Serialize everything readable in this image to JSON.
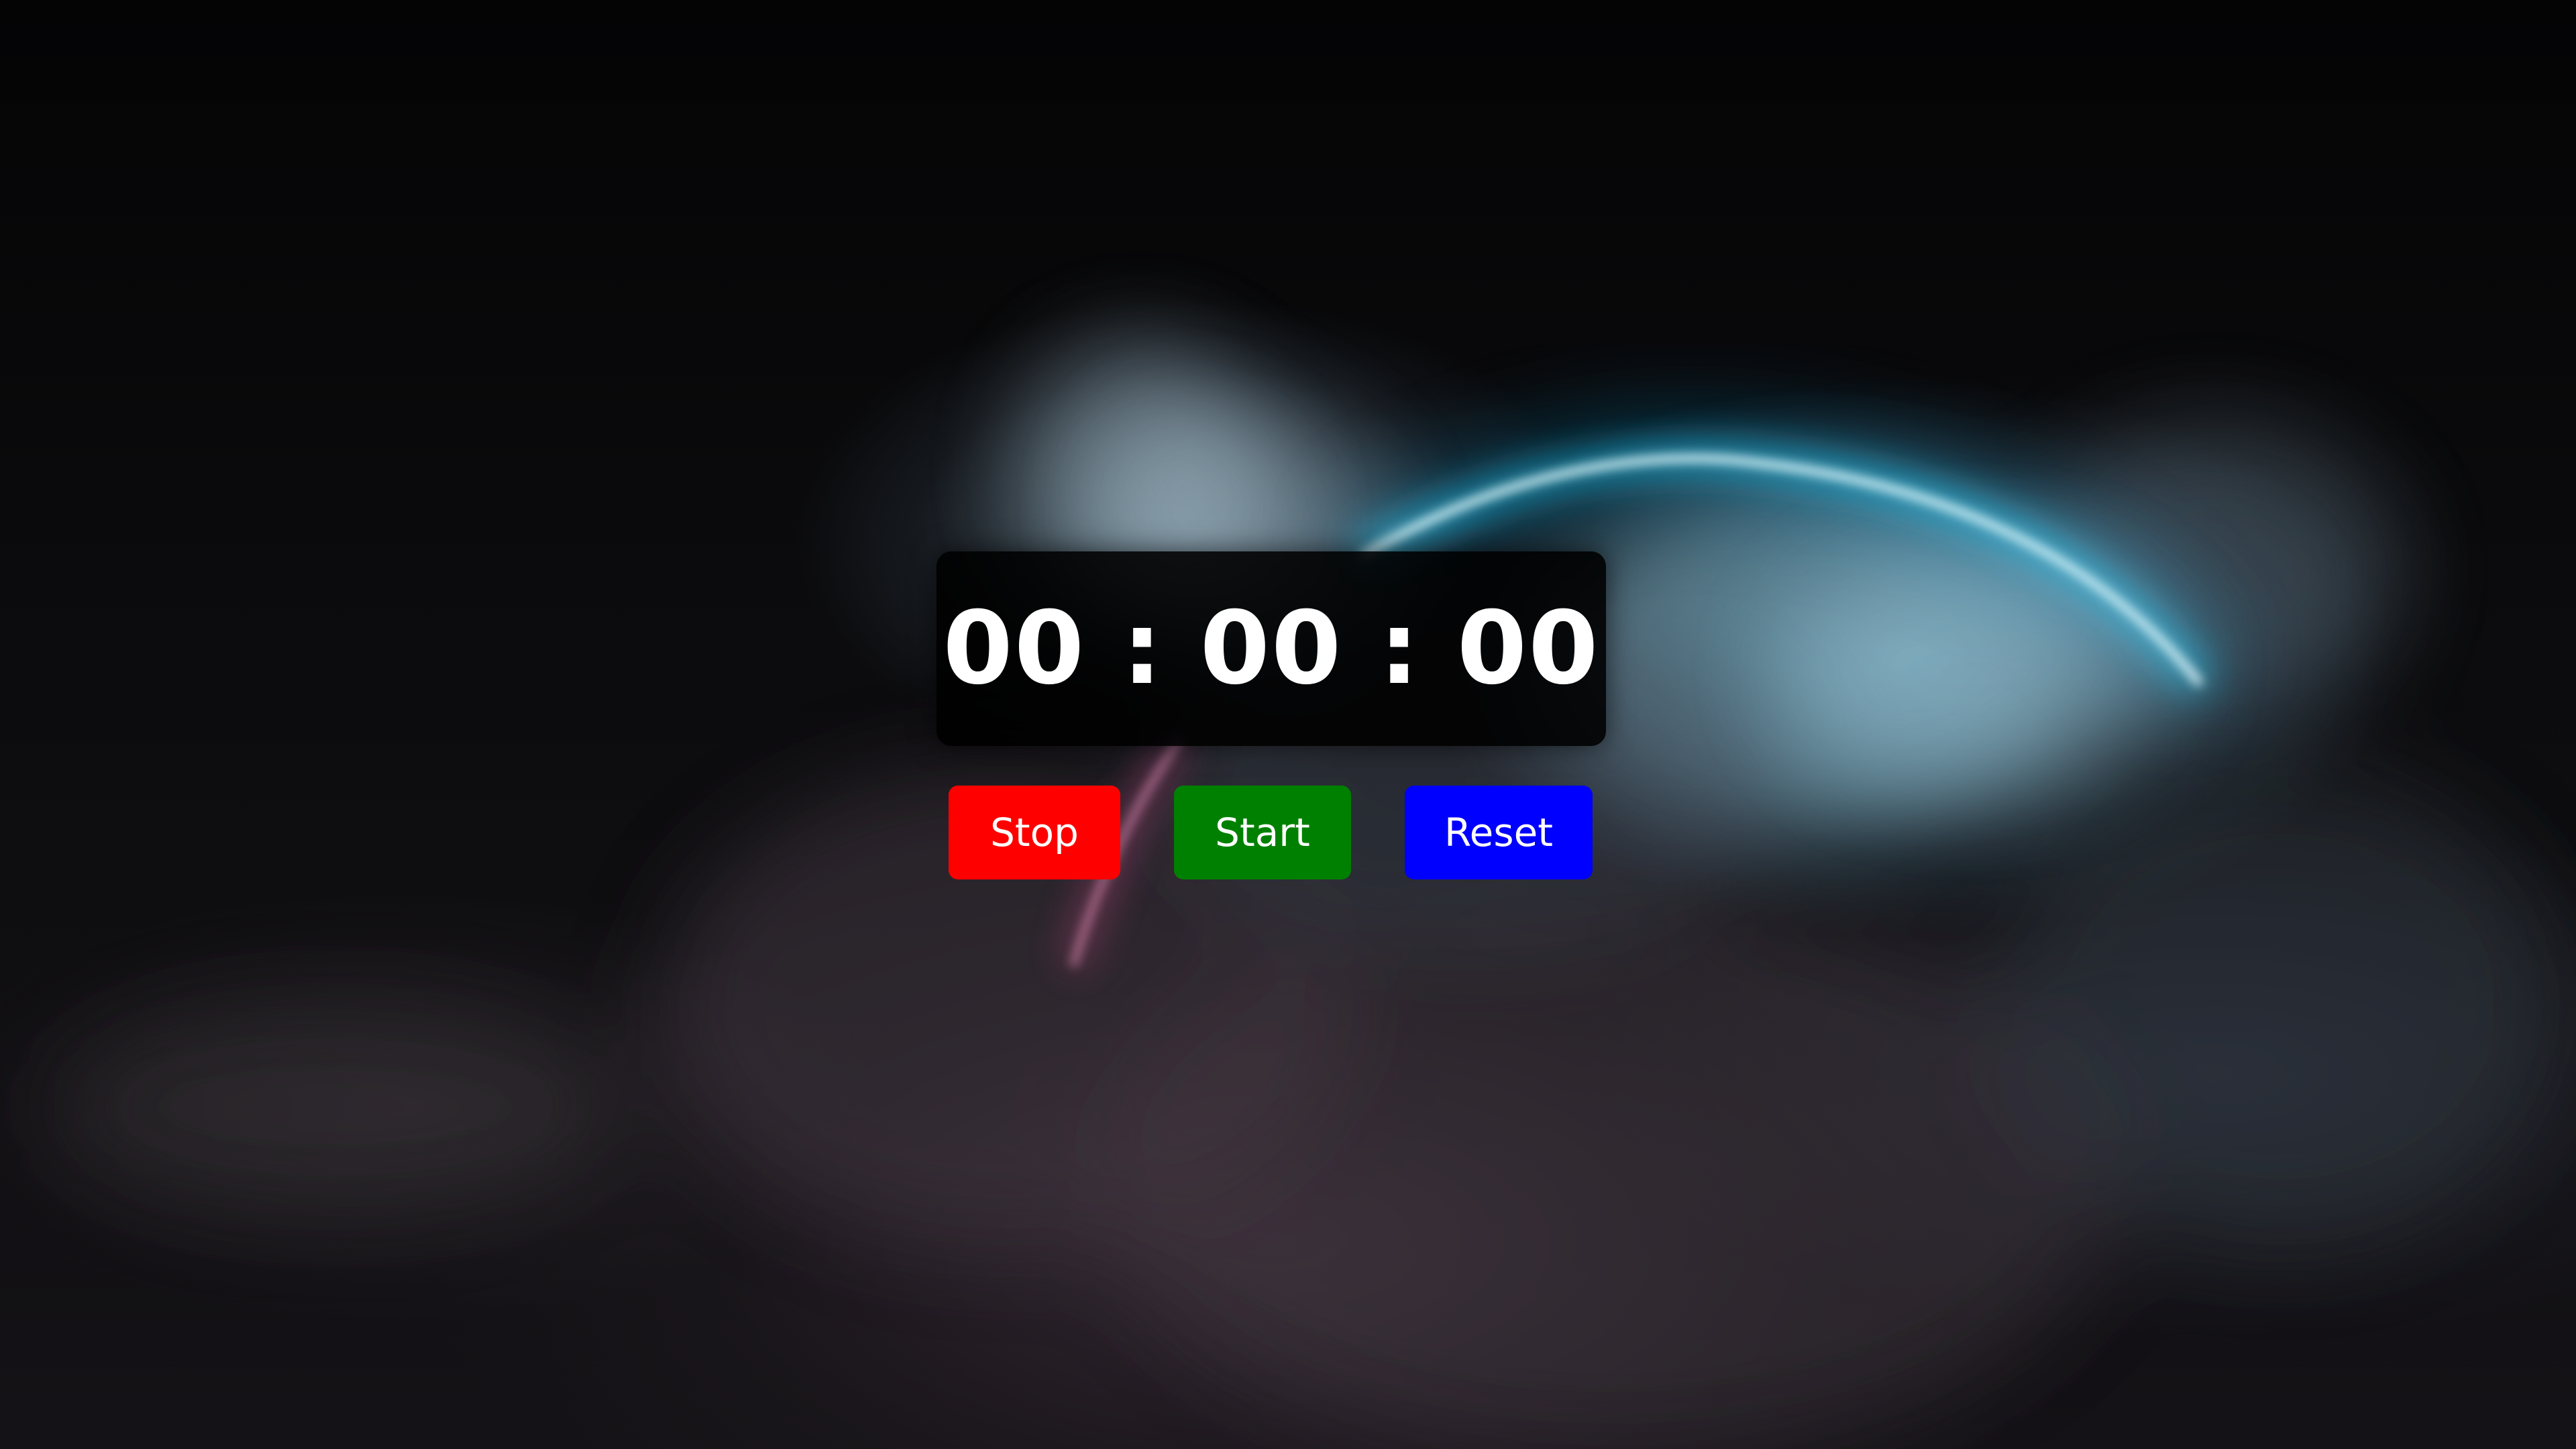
{
  "timer": {
    "display": "00 : 00 : 00"
  },
  "controls": {
    "stop_label": "Stop",
    "start_label": "Start",
    "reset_label": "Reset"
  },
  "colors": {
    "stop": "#ff0000",
    "start": "#008000",
    "reset": "#0000ff",
    "panel": "#000000",
    "glow_ring": "#22d3ff"
  }
}
